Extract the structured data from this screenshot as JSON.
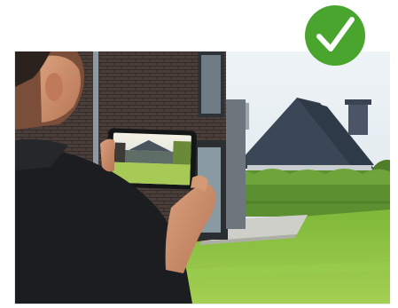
{
  "image": {
    "subject": "person-holding-tablet-photographing-house-and-garden"
  },
  "badge": {
    "icon": "checkmark-icon",
    "status": "approved",
    "color": "#4aa52e"
  },
  "colors": {
    "sky": "#e4ecf2",
    "brick": "#4a3f3b",
    "lawn": "#8fc43f",
    "hedge": "#5b8f2e",
    "roof": "#3a4656",
    "shirt": "#1b1c1e",
    "skin": "#c98c6c"
  }
}
